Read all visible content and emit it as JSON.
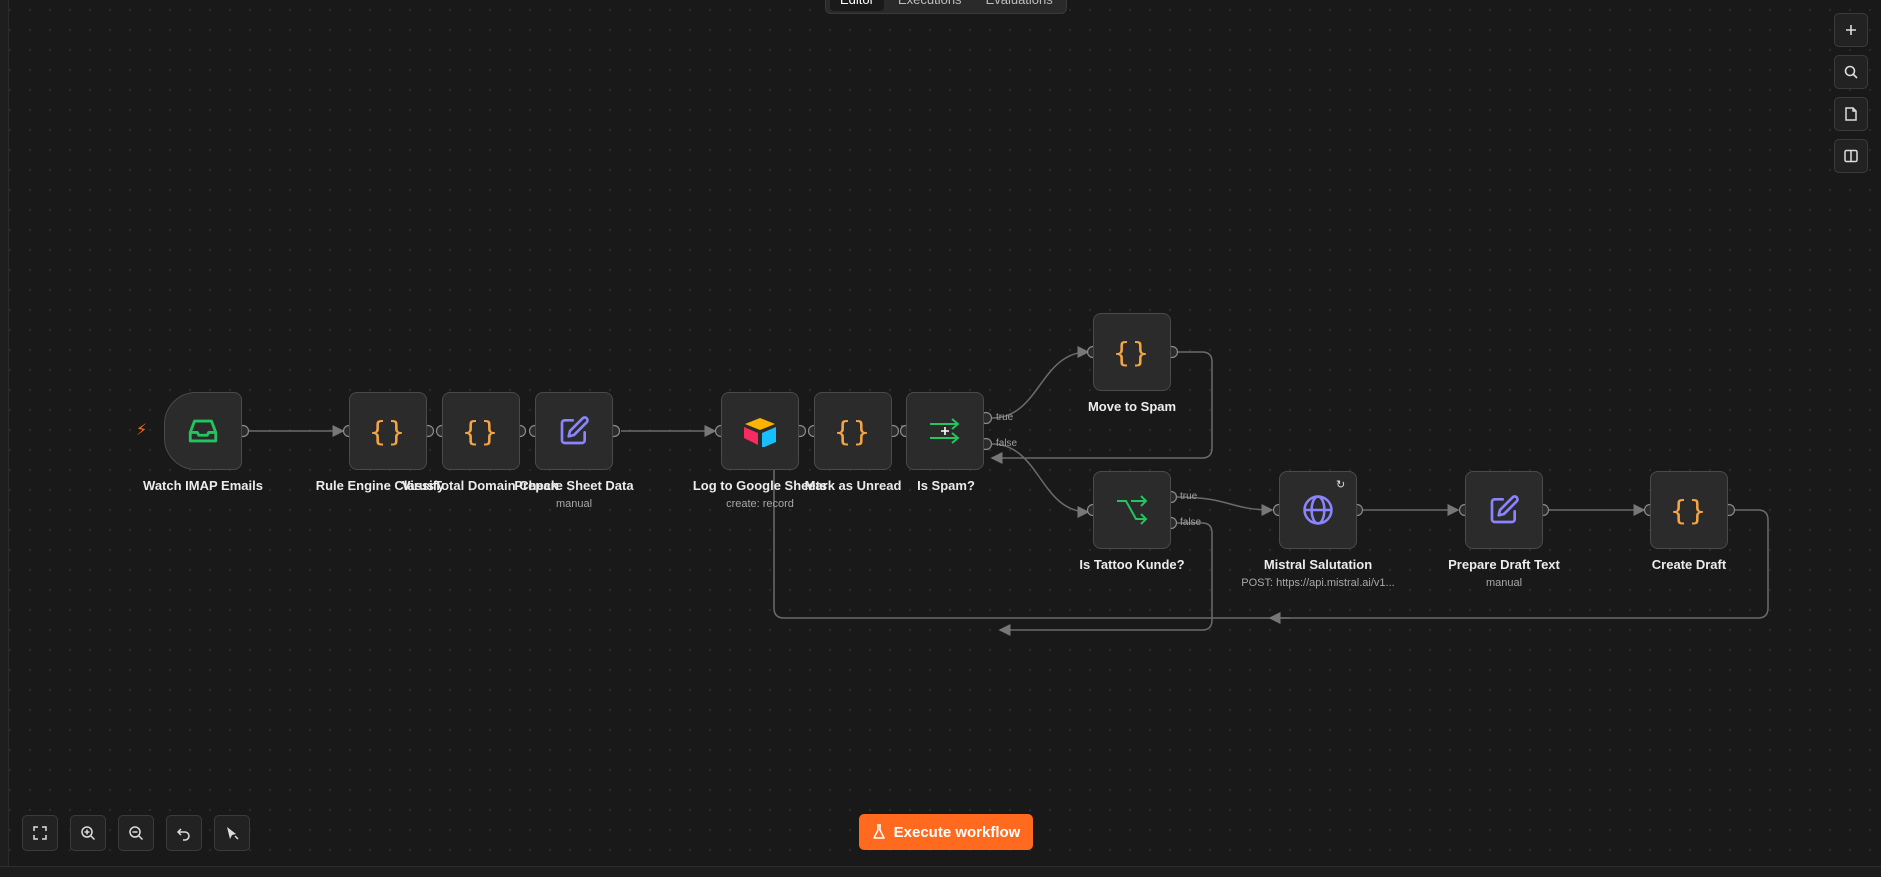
{
  "tabs": [
    "Editor",
    "Executions",
    "Evaluations"
  ],
  "nodes": {
    "watch_imap": {
      "label": "Watch IMAP Emails"
    },
    "rule_engine": {
      "label": "Rule Engine Classify"
    },
    "virustotal": {
      "label": "VirusTotal Domain Check"
    },
    "prepare_sheet": {
      "label": "Prepare Sheet Data",
      "sub": "manual"
    },
    "log_sheets": {
      "label": "Log to Google Sheets",
      "sub": "create: record"
    },
    "mark_unread": {
      "label": "Mark as Unread"
    },
    "is_spam": {
      "label": "Is Spam?"
    },
    "move_spam": {
      "label": "Move to Spam"
    },
    "is_tattoo": {
      "label": "Is Tattoo Kunde?"
    },
    "mistral": {
      "label": "Mistral Salutation",
      "sub": "POST: https://api.mistral.ai/v1..."
    },
    "prepare_draft": {
      "label": "Prepare Draft Text",
      "sub": "manual"
    },
    "create_draft": {
      "label": "Create Draft"
    }
  },
  "branches": {
    "true": "true",
    "false": "false"
  },
  "execute_button": {
    "label": "Execute workflow"
  },
  "icons": {
    "trigger": "lightning-bolt-icon",
    "inbox": "inbox-icon",
    "code": "code-braces-icon",
    "edit": "pencil-square-icon",
    "airtable": "airtable-logo-icon",
    "switch": "switch-arrows-icon",
    "if": "branch-if-icon",
    "globe": "globe-icon",
    "plus": "plus-icon",
    "search": "search-icon",
    "sticky": "sticky-note-icon",
    "panel": "panel-toggle-icon",
    "fit": "fit-view-icon",
    "zoom_in": "zoom-in-icon",
    "zoom_out": "zoom-out-icon",
    "undo": "undo-icon",
    "tidy": "tidy-up-icon",
    "flask": "flask-icon"
  },
  "colors": {
    "accent": "#ff6a1f",
    "code": "#f5a542",
    "edit": "#8b84ff",
    "green": "#22c55e",
    "canvas": "#191919"
  }
}
